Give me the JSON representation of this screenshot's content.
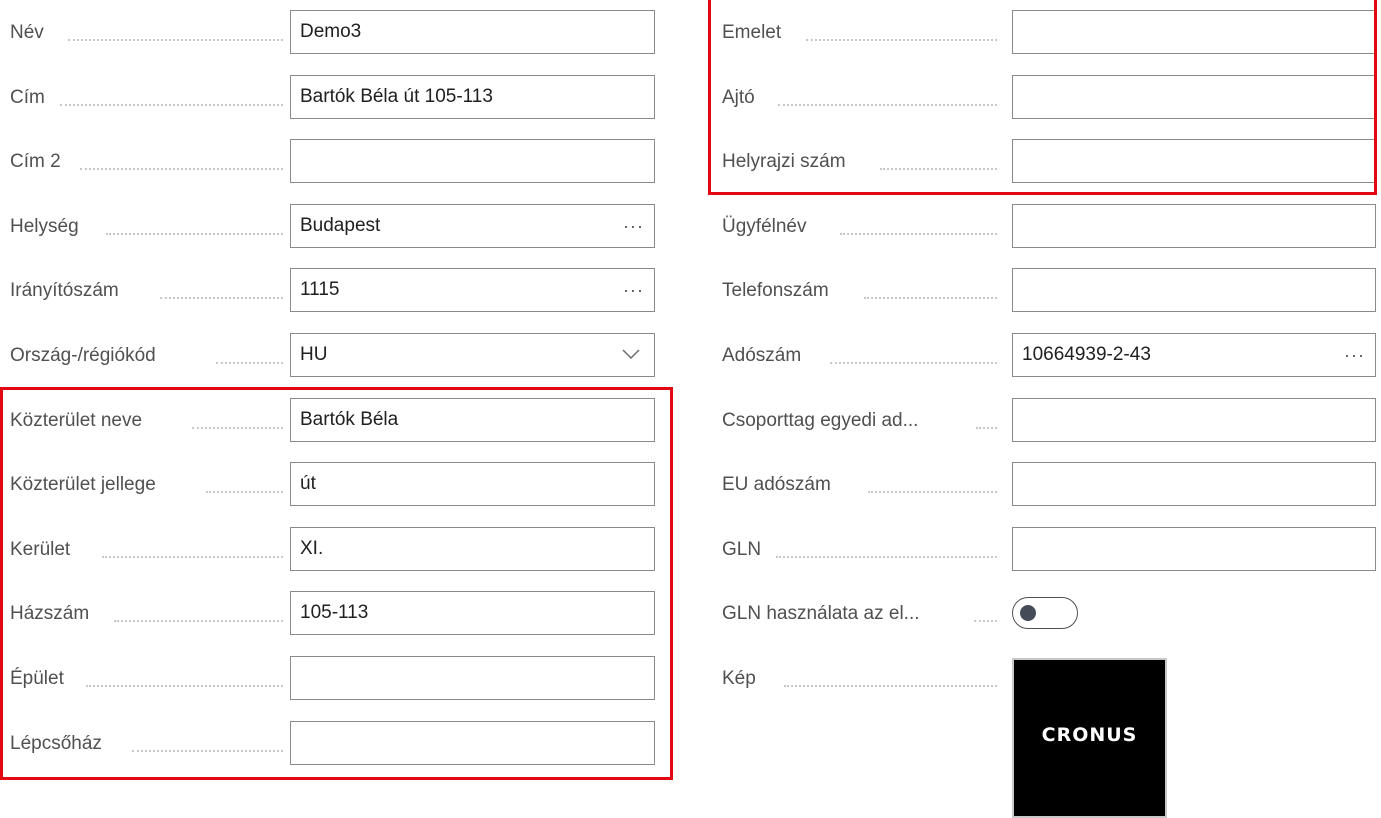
{
  "left_fields": [
    {
      "label": "Név",
      "value": "Demo3",
      "trailing": ""
    },
    {
      "label": "Cím",
      "value": "Bartók Béla út 105-113",
      "trailing": ""
    },
    {
      "label": "Cím 2",
      "value": "",
      "trailing": ""
    },
    {
      "label": "Helység",
      "value": "Budapest",
      "trailing": "···"
    },
    {
      "label": "Irányítószám",
      "value": "1115",
      "trailing": "···"
    },
    {
      "label": "Ország-/régiókód",
      "value": "HU",
      "trailing": "chevron-down-icon"
    },
    {
      "label": "Közterület neve",
      "value": "Bartók Béla",
      "trailing": ""
    },
    {
      "label": "Közterület jellege",
      "value": "út",
      "trailing": ""
    },
    {
      "label": "Kerület",
      "value": "XI.",
      "trailing": ""
    },
    {
      "label": "Házszám",
      "value": "105-113",
      "trailing": ""
    },
    {
      "label": "Épület",
      "value": "",
      "trailing": ""
    },
    {
      "label": "Lépcsőház",
      "value": "",
      "trailing": ""
    }
  ],
  "right_fields": [
    {
      "label": "Emelet",
      "value": "",
      "trailing": ""
    },
    {
      "label": "Ajtó",
      "value": "",
      "trailing": ""
    },
    {
      "label": "Helyrajzi szám",
      "value": "",
      "trailing": ""
    },
    {
      "label": "Ügyfélnév",
      "value": "",
      "trailing": ""
    },
    {
      "label": "Telefonszám",
      "value": "",
      "trailing": ""
    },
    {
      "label": "Adószám",
      "value": "10664939-2-43",
      "trailing": "···"
    },
    {
      "label": "Csoporttag egyedi ad...",
      "value": "",
      "trailing": ""
    },
    {
      "label": "EU adószám",
      "value": "",
      "trailing": ""
    },
    {
      "label": "GLN",
      "value": "",
      "trailing": ""
    }
  ],
  "gln_toggle": {
    "label": "GLN használata az el...",
    "state": "off"
  },
  "picture": {
    "label": "Kép",
    "logo_text": "CRONUS"
  },
  "colors": {
    "highlight_border": "#e30613",
    "input_border": "#8a8a8a",
    "label_text": "#505050",
    "value_text": "#202020",
    "logo_background": "#000000"
  }
}
